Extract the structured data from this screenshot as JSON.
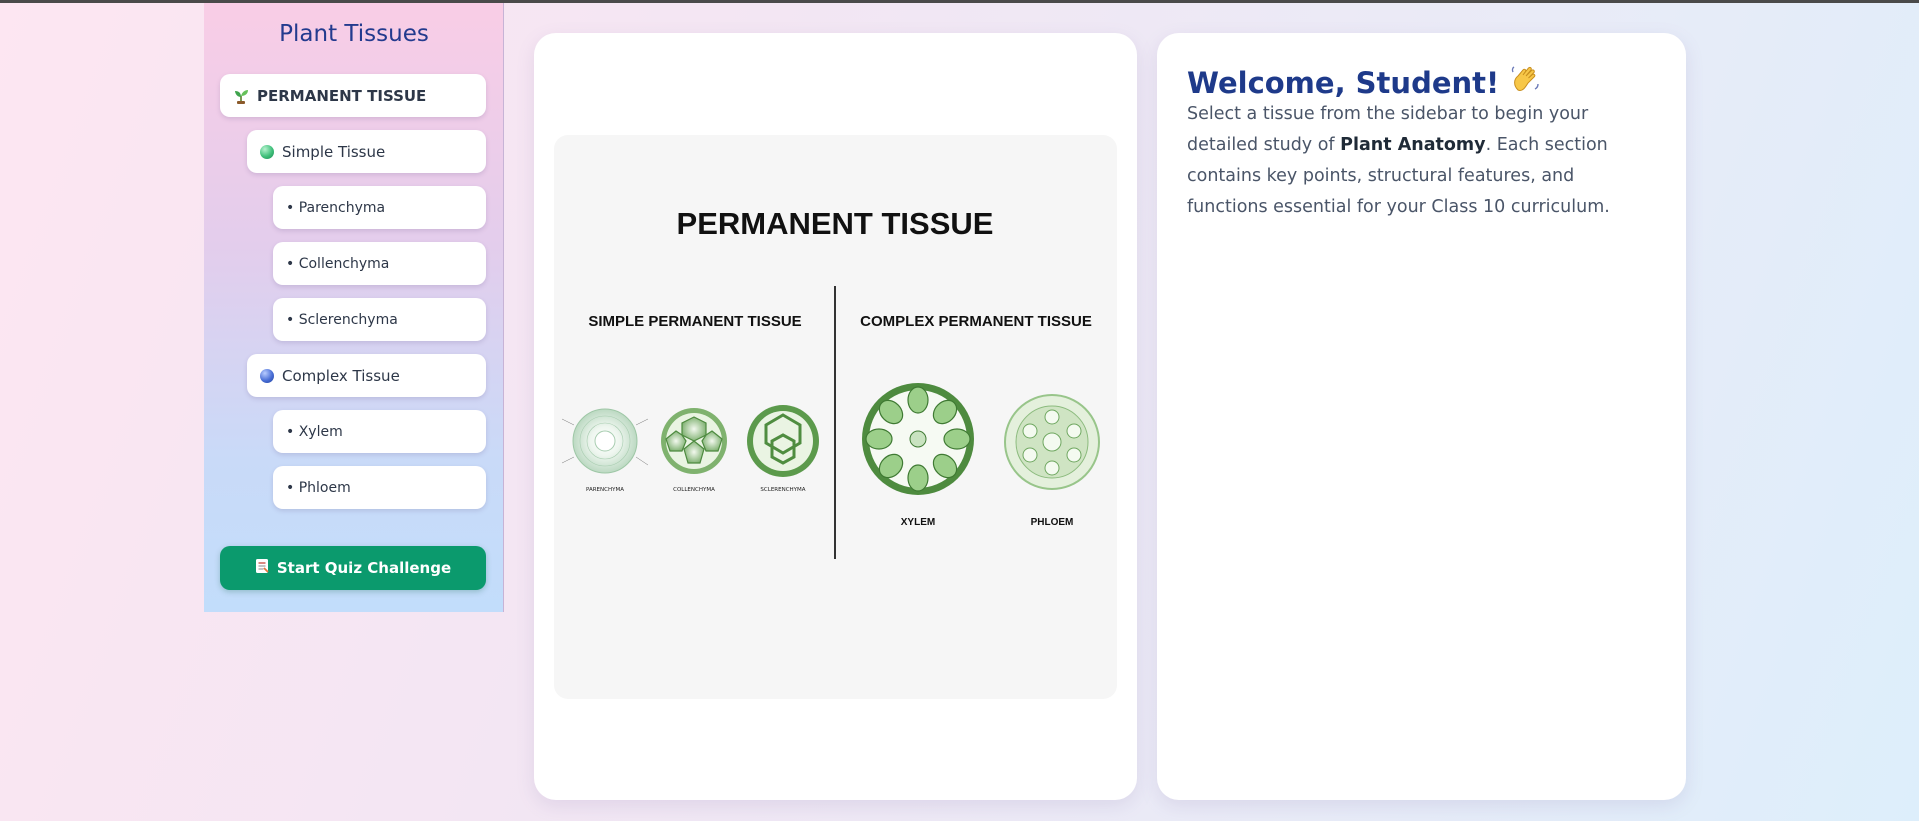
{
  "sidebar": {
    "title": "Plant Tissues",
    "items": [
      {
        "label": "PERMANENT TISSUE",
        "icon": "seedling-icon"
      },
      {
        "label": "Simple Tissue",
        "icon": "green-dot-icon"
      },
      {
        "label": "• Parenchyma"
      },
      {
        "label": "• Collenchyma"
      },
      {
        "label": "• Sclerenchyma"
      },
      {
        "label": "Complex Tissue",
        "icon": "blue-dot-icon"
      },
      {
        "label": "• Xylem"
      },
      {
        "label": "• Phloem"
      }
    ],
    "quiz_button": {
      "label": "Start Quiz Challenge",
      "icon": "memo-icon"
    }
  },
  "diagram": {
    "title": "PERMANENT TISSUE",
    "left_heading": "SIMPLE PERMANENT TISSUE",
    "right_heading": "COMPLEX PERMANENT TISSUE",
    "simple_labels": [
      "PARENCHYMA",
      "COLLENCHYMA",
      "SCLERENCHYMA"
    ],
    "complex_labels": [
      "XYLEM",
      "PHLOEM"
    ]
  },
  "welcome": {
    "heading": "Welcome, Student!",
    "heading_icon": "waving-hand-icon",
    "text_before": "Select a tissue from the sidebar to begin your detailed study of ",
    "text_bold": "Plant Anatomy",
    "text_after": ". Each section contains key points, structural features, and functions essential for your Class 10 curriculum."
  },
  "colors": {
    "accent": "#1e3a8a",
    "quiz_button": "#0b9a6d",
    "sidebar_gradient_top": "#f9cde6",
    "sidebar_gradient_bottom": "#c2ddfb"
  }
}
